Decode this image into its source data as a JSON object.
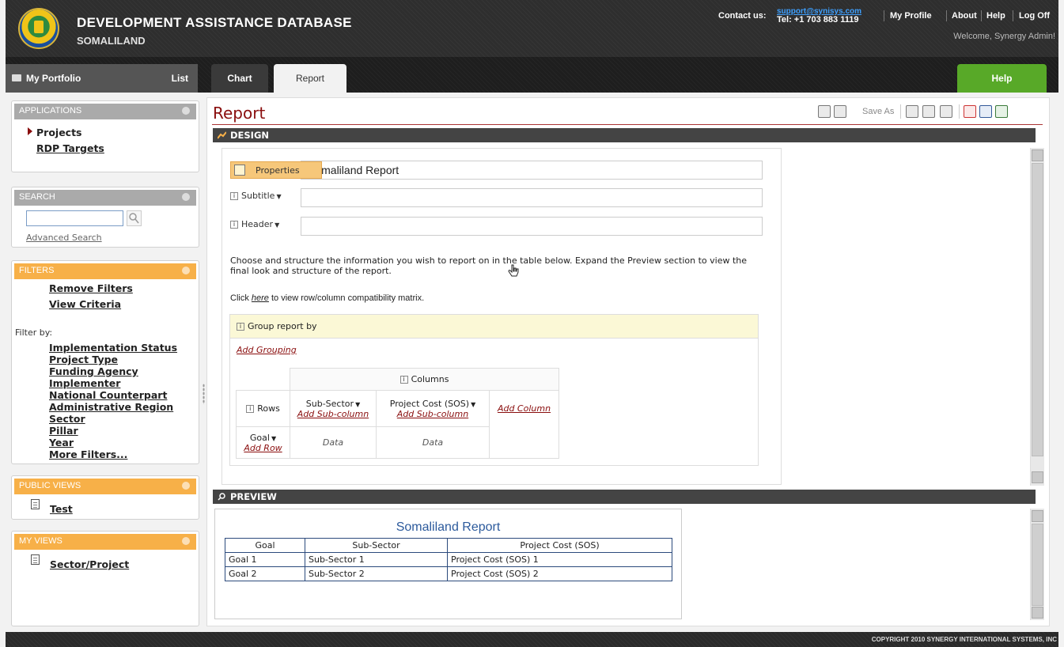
{
  "header": {
    "title": "DEVELOPMENT ASSISTANCE DATABASE",
    "subtitle": "SOMALILAND",
    "contact_label": "Contact us:",
    "contact_email": "support@synisys.com",
    "contact_tel": "Tel: +1 703 883 1119",
    "links": {
      "profile": "My Profile",
      "about": "About",
      "help": "Help",
      "logoff": "Log Off"
    },
    "welcome": "Welcome, Synergy Admin!"
  },
  "tabs": {
    "portfolio": "My Portfolio",
    "list": "List",
    "chart": "Chart",
    "report": "Report",
    "help": "Help"
  },
  "sidebar": {
    "applications": {
      "title": "APPLICATIONS",
      "items": [
        "Projects",
        "RDP Targets"
      ]
    },
    "search": {
      "title": "SEARCH",
      "value": "",
      "advanced": "Advanced Search"
    },
    "filters": {
      "title": "FILTERS",
      "remove": "Remove Filters",
      "view_criteria": "View Criteria",
      "filter_by": "Filter by:",
      "items": [
        "Implementation Status",
        "Project Type",
        "Funding Agency",
        "Implementer",
        "National Counterpart",
        "Administrative Region",
        "Sector",
        "Pillar",
        "Year",
        "More Filters..."
      ]
    },
    "public_views": {
      "title": "PUBLIC VIEWS",
      "items": [
        "Test"
      ]
    },
    "my_views": {
      "title": "MY VIEWS",
      "items": [
        "Sector/Project"
      ]
    }
  },
  "main": {
    "title": "Report",
    "save_as": "Save As",
    "design": {
      "title": "DESIGN",
      "properties": "Properties",
      "report_title_value": "Somaliland Report",
      "subtitle_label": "Subtitle",
      "subtitle_value": "",
      "header_label": "Header",
      "header_value": "",
      "instructions": "Choose and structure the information you wish to report on in the table below. Expand the Preview section to view the final look and structure of the report.",
      "compat_prefix": "Click ",
      "compat_link": "here",
      "compat_suffix": " to view row/column compatibility matrix.",
      "group_label": "Group report by",
      "add_grouping": "Add Grouping",
      "columns_label": "Columns",
      "rows_label": "Rows",
      "col1": "Sub-Sector",
      "col2": "Project Cost (SOS)",
      "add_subcolumn": "Add Sub-column",
      "add_column": "Add Column",
      "row1": "Goal",
      "add_row": "Add Row",
      "data": "Data"
    },
    "preview": {
      "title": "PREVIEW",
      "report_title": "Somaliland Report",
      "headers": [
        "Goal",
        "Sub-Sector",
        "Project Cost (SOS)"
      ],
      "rows": [
        [
          "Goal 1",
          "Sub-Sector 1",
          "Project Cost (SOS) 1"
        ],
        [
          "Goal 2",
          "Sub-Sector 2",
          "Project Cost (SOS) 2"
        ]
      ]
    }
  },
  "footer": {
    "copyright": "COPYRIGHT 2010 SYNERGY INTERNATIONAL SYSTEMS, INC"
  }
}
